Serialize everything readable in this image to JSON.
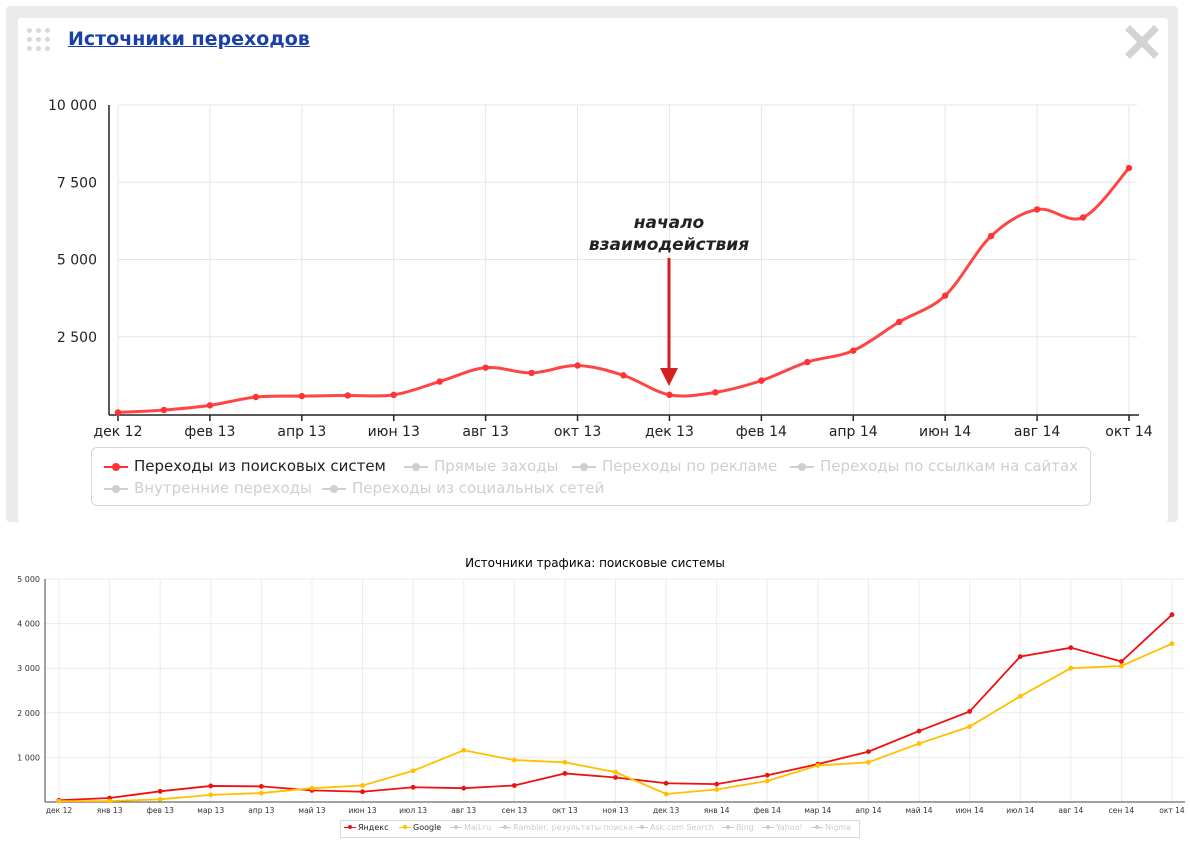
{
  "widget": {
    "title": "Источники переходов"
  },
  "annotation": {
    "line1": "начало",
    "line2": "взаимодействия"
  },
  "chart_data": [
    {
      "type": "line",
      "title": "Источники переходов",
      "x_ticks": [
        "дек 12",
        "фев 13",
        "апр 13",
        "июн 13",
        "авг 13",
        "окт 13",
        "дек 13",
        "фев 14",
        "апр 14",
        "июн 14",
        "авг 14",
        "окт 14"
      ],
      "y_ticks": [
        "10 000",
        "7 500",
        "5 000",
        "2 500"
      ],
      "ylim": [
        0,
        10000
      ],
      "x_count": 23,
      "series": [
        {
          "name": "Переходы из поисковых систем",
          "color": "#ff3333",
          "active": true,
          "values": [
            50,
            130,
            280,
            550,
            580,
            600,
            620,
            1050,
            1500,
            1330,
            1570,
            1250,
            620,
            700,
            1080,
            1680,
            2050,
            2980,
            3830,
            5760,
            6620,
            6360,
            7960
          ]
        },
        {
          "name": "Прямые заходы",
          "active": false
        },
        {
          "name": "Переходы по рекламе",
          "active": false
        },
        {
          "name": "Переходы по ссылкам на сайтах",
          "active": false
        },
        {
          "name": "Внутренние переходы",
          "active": false
        },
        {
          "name": "Переходы из социальных сетей",
          "active": false
        }
      ],
      "annotation": "начало взаимодействия",
      "annotation_x_index": 12,
      "grid": true
    },
    {
      "type": "line",
      "title": "Источники трафика: поисковые системы",
      "categories": [
        "дек 12",
        "янв 13",
        "фев 13",
        "мар 13",
        "апр 13",
        "май 13",
        "июн 13",
        "июл 13",
        "авг 13",
        "сен 13",
        "окт 13",
        "ноя 13",
        "дек 13",
        "янв 14",
        "фев 14",
        "мар 14",
        "апр 14",
        "май 14",
        "июн 14",
        "июл 14",
        "авг 14",
        "сен 14",
        "окт 14"
      ],
      "y_ticks": [
        "5 000",
        "4 000",
        "3 000",
        "2 000",
        "1 000"
      ],
      "ylim": [
        0,
        5000
      ],
      "series": [
        {
          "name": "Яндекс",
          "color": "#ee1111",
          "active": true,
          "values": [
            40,
            90,
            240,
            360,
            350,
            260,
            230,
            330,
            310,
            370,
            640,
            550,
            420,
            400,
            600,
            850,
            1130,
            1590,
            2030,
            3260,
            3460,
            3150,
            4200
          ]
        },
        {
          "name": "Google",
          "color": "#ffc000",
          "active": true,
          "values": [
            20,
            20,
            60,
            160,
            200,
            310,
            370,
            700,
            1160,
            940,
            890,
            670,
            180,
            280,
            470,
            820,
            890,
            1310,
            1690,
            2370,
            3000,
            3050,
            3550
          ]
        },
        {
          "name": "Mail.ru",
          "active": false
        },
        {
          "name": "Rambler, результаты поиска",
          "active": false
        },
        {
          "name": "Ask.com Search",
          "active": false
        },
        {
          "name": "Bing",
          "active": false
        },
        {
          "name": "Yahoo!",
          "active": false
        },
        {
          "name": "Nigma",
          "active": false
        }
      ],
      "grid": true
    }
  ]
}
